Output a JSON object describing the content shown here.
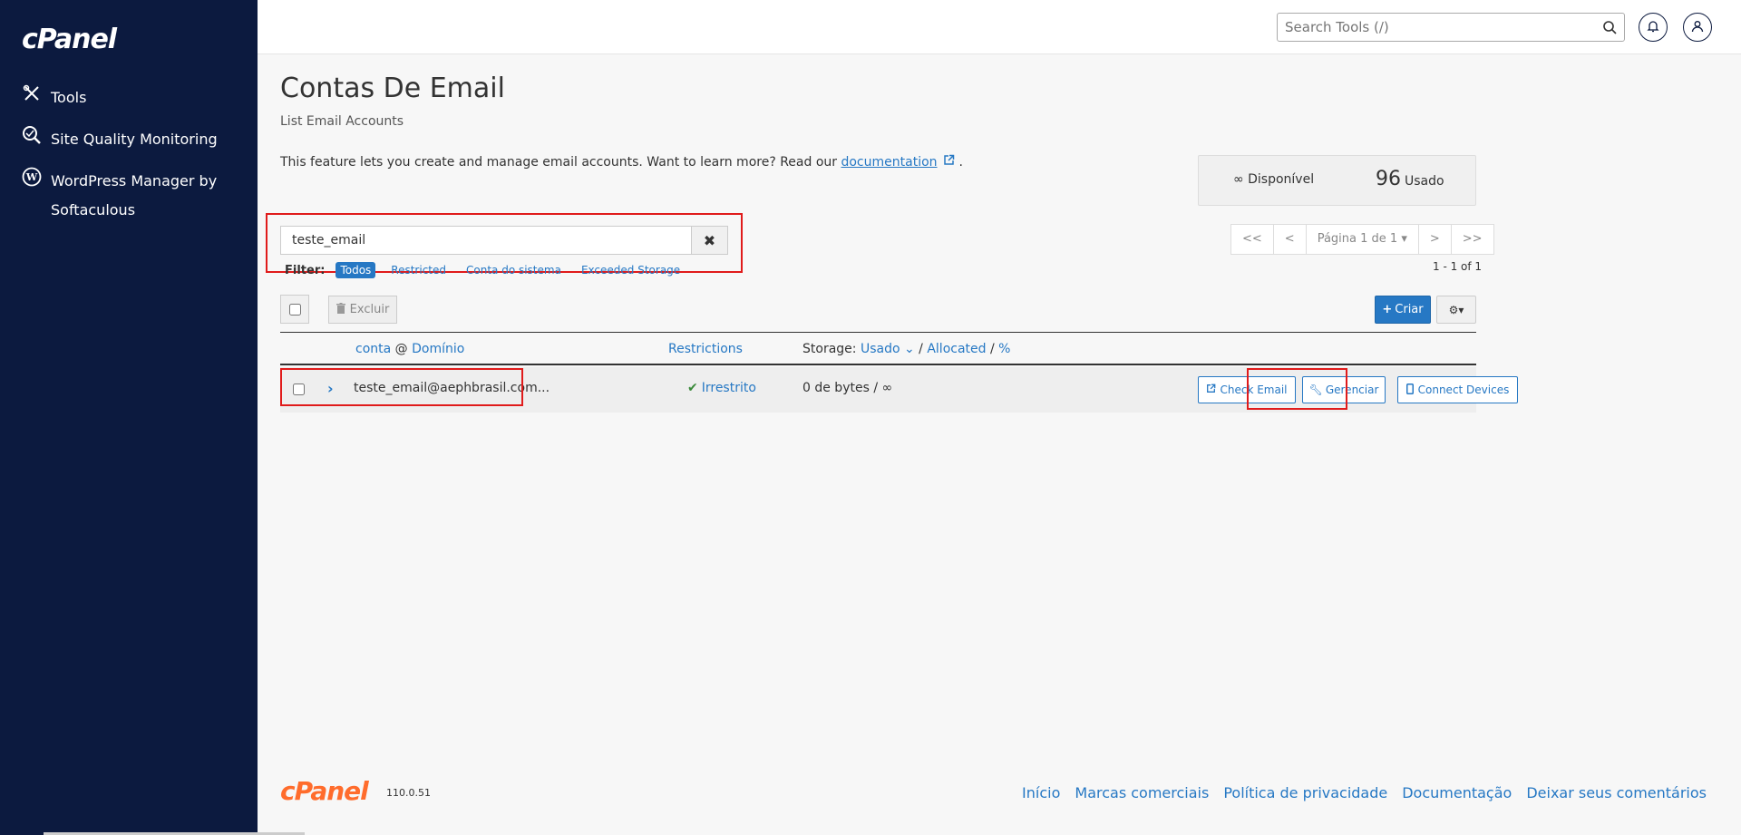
{
  "sidebar": {
    "logo": "cPanel",
    "items": [
      {
        "label": "Tools",
        "icon": "tools-icon"
      },
      {
        "label": "Site Quality Monitoring",
        "icon": "site-quality-icon"
      },
      {
        "label": "WordPress Manager by Softaculous",
        "icon": "wordpress-icon"
      }
    ]
  },
  "header": {
    "search_placeholder": "Search Tools (/)"
  },
  "page": {
    "title": "Contas De Email",
    "subtitle": "List Email Accounts",
    "description": "This feature lets you create and manage email accounts. Want to learn more? Read our",
    "doc_link": "documentation",
    "desc_end": "."
  },
  "stats": {
    "available_symbol": "∞",
    "available_label": "Disponível",
    "used_value": "96",
    "used_label": "Usado"
  },
  "search": {
    "value": "teste_email"
  },
  "filter": {
    "label": "Filter:",
    "options": [
      "Todos",
      "Restricted",
      "Conta do sistema",
      "Exceeded Storage"
    ],
    "active": "Todos"
  },
  "pager": {
    "first": "<<",
    "prev": "<",
    "page_label": "Página 1 de 1",
    "next": ">",
    "last": ">>",
    "info": "1 - 1 of 1"
  },
  "toolbar": {
    "delete_label": "Excluir",
    "create_label": "Criar"
  },
  "table": {
    "col_account": "conta",
    "col_at": "@",
    "col_domain": "Domínio",
    "col_restrictions": "Restrictions",
    "col_storage_prefix": "Storage:",
    "col_storage_used": "Usado",
    "col_sep": "/",
    "col_storage_allocated": "Allocated",
    "col_storage_pct": "%",
    "rows": [
      {
        "email": "teste_email@aephbrasil.com...",
        "restriction": "Irrestrito",
        "storage": "0 de bytes / ∞",
        "actions": [
          "Check Email",
          "Gerenciar",
          "Connect Devices"
        ]
      }
    ]
  },
  "footer": {
    "logo": "cPanel",
    "version": "110.0.51",
    "links": [
      "Início",
      "Marcas comerciais",
      "Política de privacidade",
      "Documentação",
      "Deixar seus comentários"
    ]
  },
  "colors": {
    "sidebar_bg": "#0c1a3f",
    "accent": "#2678c4",
    "highlight": "#e01b1b",
    "footer_logo": "#ff6c2c"
  }
}
